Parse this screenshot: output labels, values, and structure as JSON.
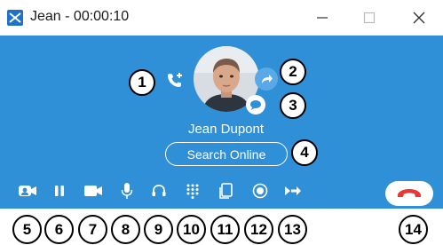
{
  "window": {
    "title": "Jean - 00:00:10",
    "controls": {
      "minimize_icon": "minimize-icon",
      "maximize_icon": "maximize-icon",
      "close_icon": "close-icon"
    }
  },
  "contact": {
    "name": "Jean Dupont"
  },
  "search_button": {
    "label": "Search Online"
  },
  "callouts": [
    "1",
    "2",
    "3",
    "4",
    "5",
    "6",
    "7",
    "8",
    "9",
    "10",
    "11",
    "12",
    "13",
    "14"
  ],
  "controls": [
    {
      "name": "video-contact-icon"
    },
    {
      "name": "pause-icon"
    },
    {
      "name": "camera-icon"
    },
    {
      "name": "microphone-icon"
    },
    {
      "name": "headset-icon"
    },
    {
      "name": "dialpad-icon"
    },
    {
      "name": "screen-share-icon"
    },
    {
      "name": "record-icon"
    },
    {
      "name": "transfer-icon"
    },
    {
      "name": "hang-up-icon"
    }
  ],
  "colors": {
    "accent": "#2f8fd7",
    "hangup": "#e53935",
    "callout_border": "#000000"
  }
}
